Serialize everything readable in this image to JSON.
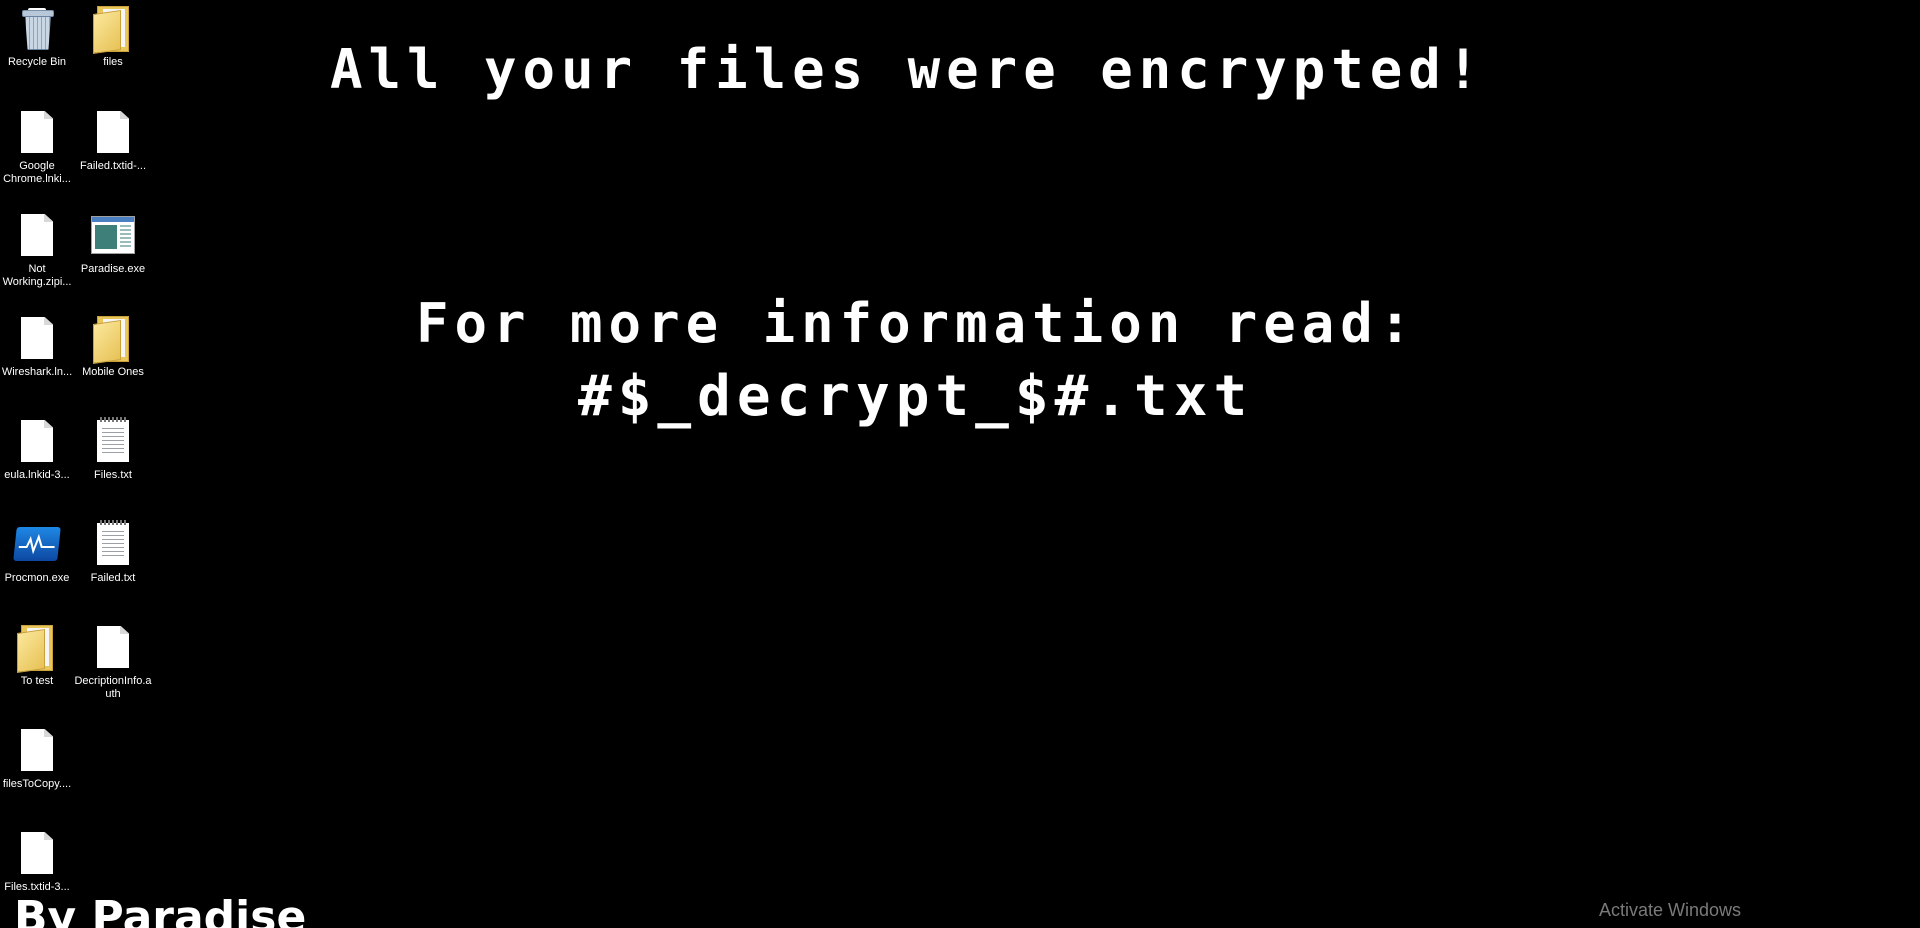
{
  "desktop": {
    "icons": [
      {
        "label": "Recycle Bin",
        "icon": "recycle-bin-icon"
      },
      {
        "label": "files",
        "icon": "folder-icon"
      },
      {
        "label": "Google Chrome.lnki...",
        "icon": "file-icon"
      },
      {
        "label": "Failed.txtid-...",
        "icon": "file-icon"
      },
      {
        "label": "Not Working.zipi...",
        "icon": "file-icon"
      },
      {
        "label": "Paradise.exe",
        "icon": "application-icon"
      },
      {
        "label": "Wireshark.ln...",
        "icon": "file-icon"
      },
      {
        "label": "Mobile Ones",
        "icon": "folder-icon"
      },
      {
        "label": "eula.lnkid-3...",
        "icon": "file-icon"
      },
      {
        "label": "Files.txt",
        "icon": "text-file-icon"
      },
      {
        "label": "Procmon.exe",
        "icon": "procmon-icon"
      },
      {
        "label": "Failed.txt",
        "icon": "text-file-icon"
      },
      {
        "label": "To test",
        "icon": "folder-icon"
      },
      {
        "label": "DecriptionInfo.auth",
        "icon": "file-icon"
      },
      {
        "label": "filesToCopy....",
        "icon": "file-icon"
      },
      {
        "label": "Files.txtid-3...",
        "icon": "file-icon"
      }
    ]
  },
  "ransom_note": {
    "headline": "All your files were encrypted!",
    "info": "For more information read:",
    "filename": "#$_decrypt_$#.txt",
    "signature": "By Paradise"
  },
  "watermark": {
    "activate_windows": "Activate Windows"
  },
  "colors": {
    "background": "#000000",
    "text": "#ffffff",
    "watermark": "#7a7a7a"
  }
}
